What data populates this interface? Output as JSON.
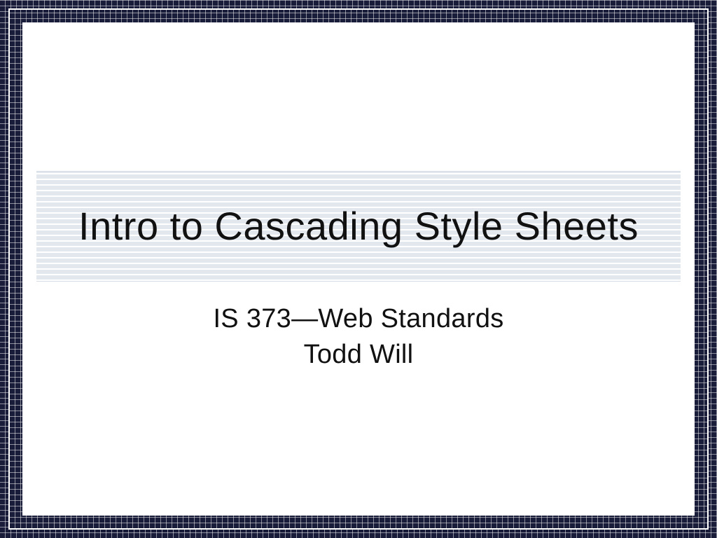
{
  "slide": {
    "title": "Intro to Cascading Style Sheets",
    "subtitle_line1": "IS 373—Web Standards",
    "subtitle_line2": "Todd Will"
  },
  "colors": {
    "frame": "#1a1d3a",
    "title_bg": "#e8ebf0",
    "text": "#111111"
  }
}
